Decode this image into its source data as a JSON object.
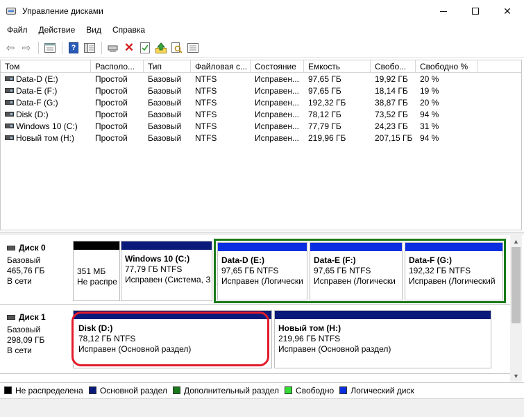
{
  "window": {
    "title": "Управление дисками"
  },
  "menu": [
    "Файл",
    "Действие",
    "Вид",
    "Справка"
  ],
  "toolbar": {
    "icons": [
      "back-icon",
      "forward-icon",
      "properties-icon",
      "help-icon",
      "view-icon",
      "connect-icon",
      "delete-icon",
      "checklist-icon",
      "upload-icon",
      "find-icon",
      "details-icon"
    ]
  },
  "table": {
    "headers": [
      "Том",
      "Располо...",
      "Тип",
      "Файловая с...",
      "Состояние",
      "Емкость",
      "Свобо...",
      "Свободно %"
    ],
    "rows": [
      [
        "Data-D (E:)",
        "Простой",
        "Базовый",
        "NTFS",
        "Исправен...",
        "97,65 ГБ",
        "19,92 ГБ",
        "20 %"
      ],
      [
        "Data-E (F:)",
        "Простой",
        "Базовый",
        "NTFS",
        "Исправен...",
        "97,65 ГБ",
        "18,14 ГБ",
        "19 %"
      ],
      [
        "Data-F (G:)",
        "Простой",
        "Базовый",
        "NTFS",
        "Исправен...",
        "192,32 ГБ",
        "38,87 ГБ",
        "20 %"
      ],
      [
        "Disk (D:)",
        "Простой",
        "Базовый",
        "NTFS",
        "Исправен...",
        "78,12 ГБ",
        "73,52 ГБ",
        "94 %"
      ],
      [
        "Windows 10 (C:)",
        "Простой",
        "Базовый",
        "NTFS",
        "Исправен...",
        "77,79 ГБ",
        "24,23 ГБ",
        "31 %"
      ],
      [
        "Новый том (H:)",
        "Простой",
        "Базовый",
        "NTFS",
        "Исправен...",
        "219,96 ГБ",
        "207,15 ГБ",
        "94 %"
      ]
    ]
  },
  "disks": [
    {
      "name": "Диск 0",
      "type": "Базовый",
      "size": "465,76 ГБ",
      "status": "В сети",
      "partitions": [
        {
          "title": "",
          "line1": "351 МБ",
          "line2": "Не распре"
        },
        {
          "title": "Windows 10  (C:)",
          "line1": "77,79 ГБ NTFS",
          "line2": "Исправен (Система, З"
        },
        {
          "title": "Data-D  (E:)",
          "line1": "97,65 ГБ NTFS",
          "line2": "Исправен (Логически"
        },
        {
          "title": "Data-E  (F:)",
          "line1": "97,65 ГБ NTFS",
          "line2": "Исправен (Логически"
        },
        {
          "title": "Data-F  (G:)",
          "line1": "192,32 ГБ NTFS",
          "line2": "Исправен (Логический"
        }
      ]
    },
    {
      "name": "Диск 1",
      "type": "Базовый",
      "size": "298,09 ГБ",
      "status": "В сети",
      "partitions": [
        {
          "title": "Disk  (D:)",
          "line1": "78,12 ГБ NTFS",
          "line2": "Исправен (Основной раздел)"
        },
        {
          "title": "Новый том  (H:)",
          "line1": "219,96 ГБ NTFS",
          "line2": "Исправен (Основной раздел)"
        }
      ]
    }
  ],
  "legend": [
    {
      "label": "Не распределена",
      "color": "#000000"
    },
    {
      "label": "Основной раздел",
      "color": "#0a1a7a"
    },
    {
      "label": "Дополнительный раздел",
      "color": "#1a7a1a"
    },
    {
      "label": "Свободно",
      "color": "#33dd33"
    },
    {
      "label": "Логический диск",
      "color": "#0a2fe0"
    }
  ]
}
